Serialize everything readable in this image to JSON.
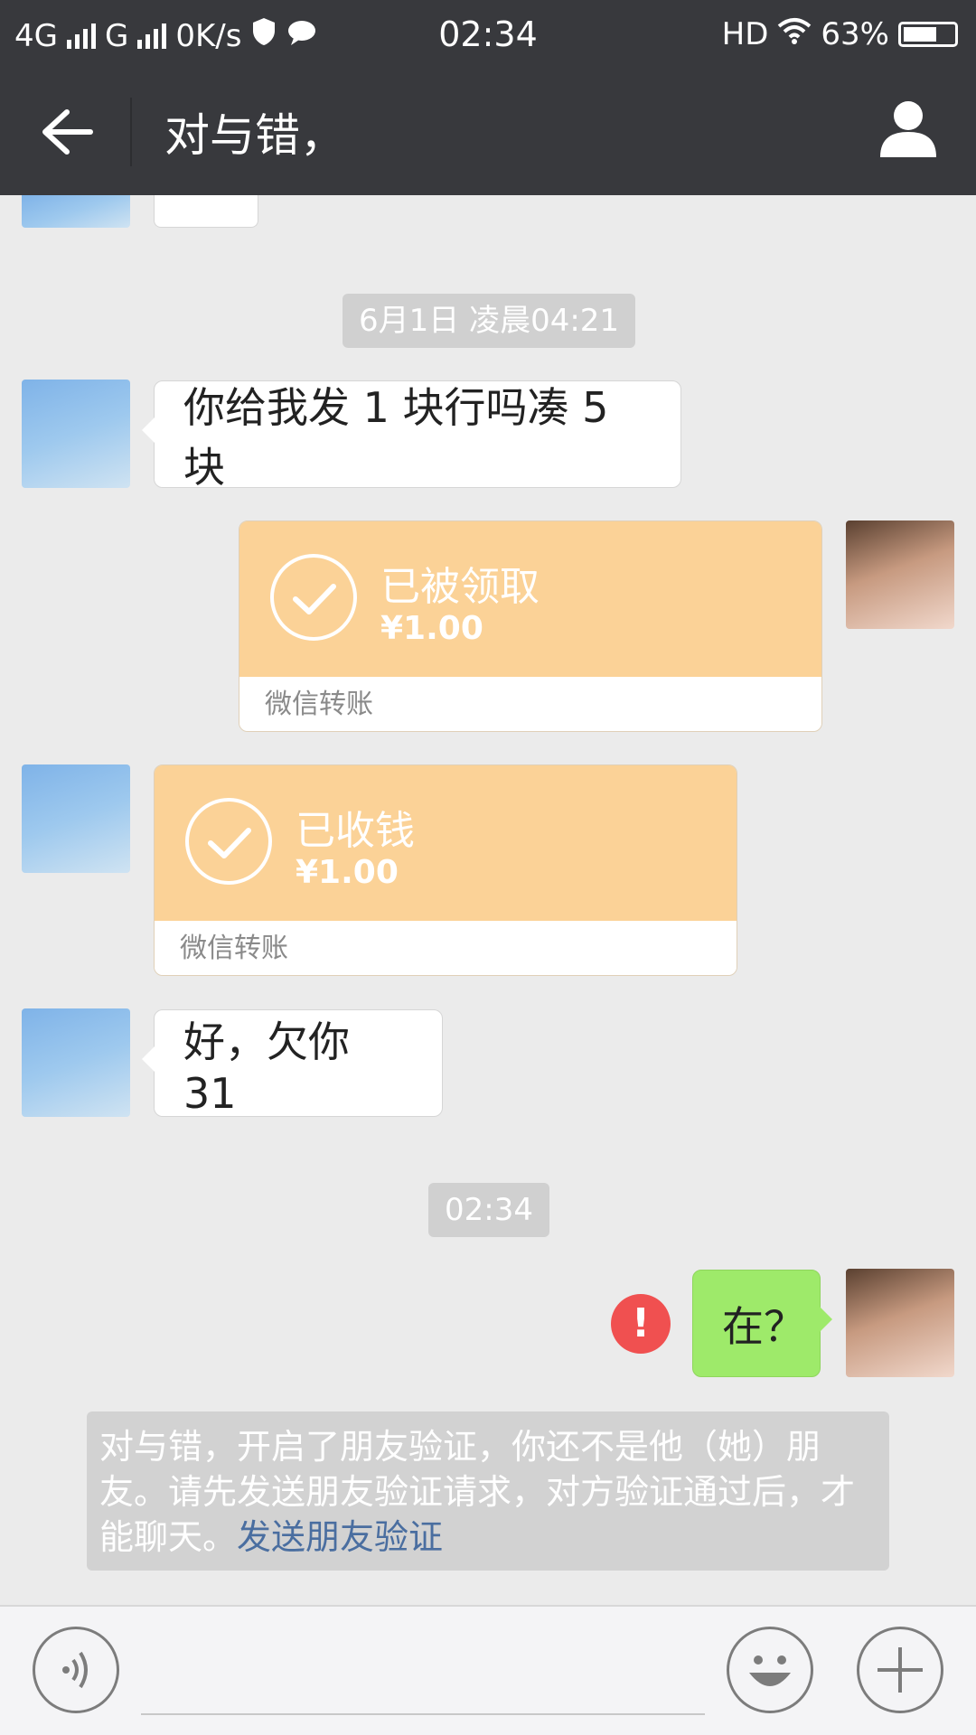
{
  "status_bar": {
    "network1": "4G",
    "network2": "G",
    "speed": "0K/s",
    "time": "02:34",
    "hd": "HD",
    "battery": "63%"
  },
  "header": {
    "title": "对与错，"
  },
  "messages": {
    "timestamp1": "6月1日 凌晨04:21",
    "msg1": "你给我发 1 块行吗凑 5 块",
    "transfer1": {
      "title": "已被领取",
      "amount": "¥1.00",
      "footer": "微信转账"
    },
    "transfer2": {
      "title": "已收钱",
      "amount": "¥1.00",
      "footer": "微信转账"
    },
    "msg2": "好，欠你 31",
    "timestamp2": "02:34",
    "msg3": "在？",
    "error_mark": "!"
  },
  "system_notice": {
    "text": "对与错，开启了朋友验证，你还不是他（她）朋友。请先发送朋友验证请求，对方验证通过后，才能聊天。",
    "link": "发送朋友验证"
  },
  "input_bar": {
    "voice_icon": "voice-icon",
    "emoji_icon": "emoji-icon",
    "plus_icon": "plus-icon"
  }
}
